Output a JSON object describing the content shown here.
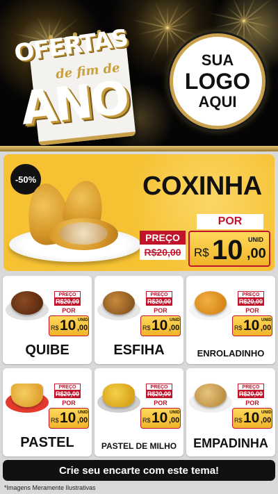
{
  "header": {
    "campaign_line1": "OFERTAS",
    "campaign_line2": "de fim de",
    "campaign_line3": "ANO",
    "logo_line1": "SUA",
    "logo_line2": "LOGO",
    "logo_line3": "AQUI"
  },
  "featured": {
    "discount": "-50%",
    "name": "COXINHA",
    "preco_label": "PREÇO",
    "old_price": "R$20,00",
    "por_label": "POR",
    "currency": "R$",
    "new_price_int": "10",
    "new_price_dec": ",00",
    "unit": "UNID"
  },
  "products": [
    {
      "name": "QUIBE",
      "preco_label": "PREÇO",
      "old_price": "R$20,00",
      "por_label": "POR",
      "currency": "R$",
      "new_price_int": "10",
      "new_price_dec": ",00",
      "unit": "UNID"
    },
    {
      "name": "ESFIHA",
      "preco_label": "PREÇO",
      "old_price": "R$20,00",
      "por_label": "POR",
      "currency": "R$",
      "new_price_int": "10",
      "new_price_dec": ",00",
      "unit": "UNID"
    },
    {
      "name": "ENROLADINHO",
      "preco_label": "PREÇO",
      "old_price": "R$20,00",
      "por_label": "POR",
      "currency": "R$",
      "new_price_int": "10",
      "new_price_dec": ",00",
      "unit": "UNID"
    },
    {
      "name": "PASTEL",
      "preco_label": "PREÇO",
      "old_price": "R$20,00",
      "por_label": "POR",
      "currency": "R$",
      "new_price_int": "10",
      "new_price_dec": ",00",
      "unit": "UNID"
    },
    {
      "name": "PASTEL DE MILHO",
      "preco_label": "PREÇO",
      "old_price": "R$20,00",
      "por_label": "POR",
      "currency": "R$",
      "new_price_int": "10",
      "new_price_dec": ",00",
      "unit": "UNID"
    },
    {
      "name": "EMPADINHA",
      "preco_label": "PREÇO",
      "old_price": "R$20,00",
      "por_label": "POR",
      "currency": "R$",
      "new_price_int": "10",
      "new_price_dec": ",00",
      "unit": "UNID"
    }
  ],
  "footer": {
    "cta": "Crie seu encarte com este tema!",
    "disclaimer": "*Imagens Meramente Ilustrativas"
  },
  "colors": {
    "accent_red": "#c1142b",
    "accent_yellow": "#f6c233",
    "gold": "#caa14d"
  }
}
